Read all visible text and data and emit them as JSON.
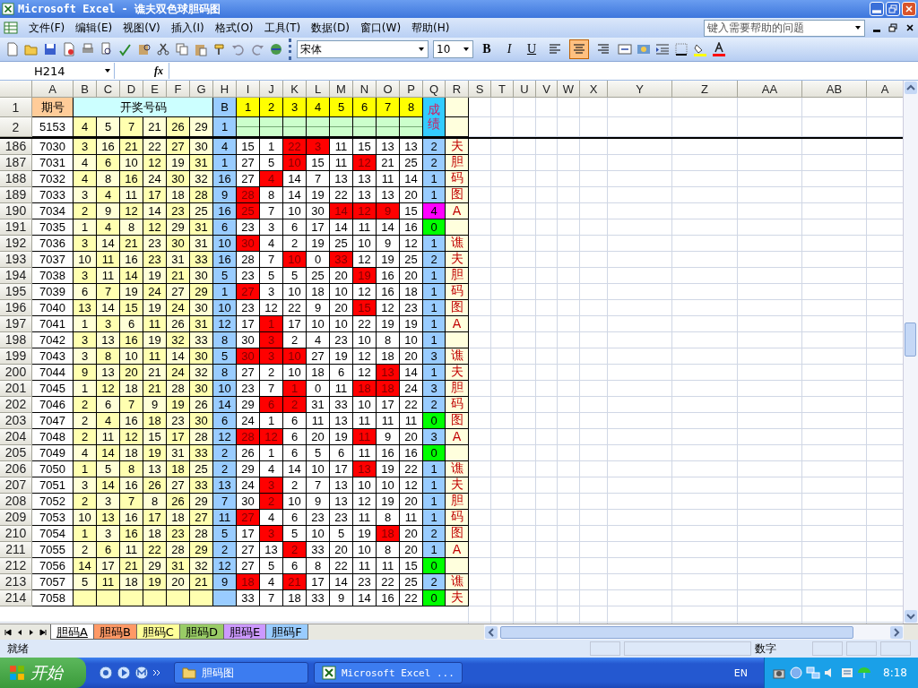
{
  "window": {
    "title": "Microsoft Excel - 谯夫双色球胆码图"
  },
  "menu": [
    "文件(F)",
    "编辑(E)",
    "视图(V)",
    "插入(I)",
    "格式(O)",
    "工具(T)",
    "数据(D)",
    "窗口(W)",
    "帮助(H)"
  ],
  "help_box": {
    "placeholder": "键入需要帮助的问题"
  },
  "format_bar": {
    "font": "宋体",
    "font_size": "10",
    "bold": "B",
    "italic": "I",
    "underline": "U",
    "alignment": [
      {
        "kind": "left",
        "selected": false
      },
      {
        "kind": "center",
        "selected": true
      },
      {
        "kind": "right",
        "selected": false
      }
    ]
  },
  "formula_bar": {
    "name_box": "H214",
    "fx": "fx"
  },
  "columns": [
    "A",
    "B",
    "C",
    "D",
    "E",
    "F",
    "G",
    "H",
    "I",
    "J",
    "K",
    "L",
    "M",
    "N",
    "O",
    "P",
    "Q",
    "R",
    "S",
    "T",
    "U",
    "V",
    "W",
    "X",
    "Y",
    "Z",
    "AA",
    "AB",
    "A"
  ],
  "header": {
    "row_1": "1",
    "row_2": "2",
    "period_label": "期号",
    "draw_label": "开奖号码",
    "blue_label": "B",
    "slots": [
      "1",
      "2",
      "3",
      "4",
      "5",
      "6",
      "7",
      "8"
    ],
    "score_label": "成绩",
    "period": "5153",
    "balls": [
      "4",
      "5",
      "7",
      "21",
      "26",
      "29"
    ],
    "blue": "1"
  },
  "rows": [
    {
      "n": "186",
      "period": "7030",
      "balls": [
        "3",
        "16",
        "21",
        "22",
        "27",
        "30"
      ],
      "blue": "4",
      "cells": [
        {
          "value": "15",
          "hit": false
        },
        {
          "value": "1",
          "hit": false
        },
        {
          "value": "22",
          "hit": true
        },
        {
          "value": "3",
          "hit": true
        },
        {
          "value": "11",
          "hit": false
        },
        {
          "value": "15",
          "hit": false
        },
        {
          "value": "13",
          "hit": false
        },
        {
          "value": "13",
          "hit": false
        }
      ],
      "score": "2",
      "color": "#99ccff",
      "note": "夫"
    },
    {
      "n": "187",
      "period": "7031",
      "balls": [
        "4",
        "6",
        "10",
        "12",
        "19",
        "31"
      ],
      "blue": "1",
      "cells": [
        {
          "value": "27",
          "hit": false
        },
        {
          "value": "5",
          "hit": false
        },
        {
          "value": "10",
          "hit": true
        },
        {
          "value": "15",
          "hit": false
        },
        {
          "value": "11",
          "hit": false
        },
        {
          "value": "12",
          "hit": true
        },
        {
          "value": "21",
          "hit": false
        },
        {
          "value": "25",
          "hit": false
        }
      ],
      "score": "2",
      "color": "#99ccff",
      "note": "胆"
    },
    {
      "n": "188",
      "period": "7032",
      "balls": [
        "4",
        "8",
        "16",
        "24",
        "30",
        "32"
      ],
      "blue": "16",
      "cells": [
        {
          "value": "27",
          "hit": false
        },
        {
          "value": "4",
          "hit": true
        },
        {
          "value": "14",
          "hit": false
        },
        {
          "value": "7",
          "hit": false
        },
        {
          "value": "13",
          "hit": false
        },
        {
          "value": "13",
          "hit": false
        },
        {
          "value": "11",
          "hit": false
        },
        {
          "value": "14",
          "hit": false
        }
      ],
      "score": "1",
      "color": "#99ccff",
      "note": "码"
    },
    {
      "n": "189",
      "period": "7033",
      "balls": [
        "3",
        "4",
        "11",
        "17",
        "18",
        "28"
      ],
      "blue": "9",
      "cells": [
        {
          "value": "28",
          "hit": true
        },
        {
          "value": "8",
          "hit": false
        },
        {
          "value": "14",
          "hit": false
        },
        {
          "value": "19",
          "hit": false
        },
        {
          "value": "22",
          "hit": false
        },
        {
          "value": "13",
          "hit": false
        },
        {
          "value": "13",
          "hit": false
        },
        {
          "value": "20",
          "hit": false
        }
      ],
      "score": "1",
      "color": "#99ccff",
      "note": "图"
    },
    {
      "n": "190",
      "period": "7034",
      "balls": [
        "2",
        "9",
        "12",
        "14",
        "23",
        "25"
      ],
      "blue": "16",
      "cells": [
        {
          "value": "25",
          "hit": true
        },
        {
          "value": "7",
          "hit": false
        },
        {
          "value": "10",
          "hit": false
        },
        {
          "value": "30",
          "hit": false
        },
        {
          "value": "14",
          "hit": true
        },
        {
          "value": "12",
          "hit": true
        },
        {
          "value": "9",
          "hit": true
        },
        {
          "value": "15",
          "hit": false
        }
      ],
      "score": "4",
      "color": "#ff00ff",
      "note": "A"
    },
    {
      "n": "191",
      "period": "7035",
      "balls": [
        "1",
        "4",
        "8",
        "12",
        "29",
        "31"
      ],
      "blue": "6",
      "cells": [
        {
          "value": "23",
          "hit": false
        },
        {
          "value": "3",
          "hit": false
        },
        {
          "value": "6",
          "hit": false
        },
        {
          "value": "17",
          "hit": false
        },
        {
          "value": "14",
          "hit": false
        },
        {
          "value": "11",
          "hit": false
        },
        {
          "value": "14",
          "hit": false
        },
        {
          "value": "16",
          "hit": false
        }
      ],
      "score": "0",
      "color": "#00ff00"
    },
    {
      "n": "192",
      "period": "7036",
      "balls": [
        "3",
        "14",
        "21",
        "23",
        "30",
        "31"
      ],
      "blue": "10",
      "cells": [
        {
          "value": "30",
          "hit": true
        },
        {
          "value": "4",
          "hit": false
        },
        {
          "value": "2",
          "hit": false
        },
        {
          "value": "19",
          "hit": false
        },
        {
          "value": "25",
          "hit": false
        },
        {
          "value": "10",
          "hit": false
        },
        {
          "value": "9",
          "hit": false
        },
        {
          "value": "12",
          "hit": false
        }
      ],
      "score": "1",
      "color": "#99ccff",
      "note": "谯"
    },
    {
      "n": "193",
      "period": "7037",
      "balls": [
        "10",
        "11",
        "16",
        "23",
        "31",
        "33"
      ],
      "blue": "16",
      "cells": [
        {
          "value": "28",
          "hit": false
        },
        {
          "value": "7",
          "hit": false
        },
        {
          "value": "10",
          "hit": true
        },
        {
          "value": "0",
          "hit": false
        },
        {
          "value": "33",
          "hit": true
        },
        {
          "value": "12",
          "hit": false
        },
        {
          "value": "19",
          "hit": false
        },
        {
          "value": "25",
          "hit": false
        }
      ],
      "score": "2",
      "color": "#99ccff",
      "note": "夫"
    },
    {
      "n": "194",
      "period": "7038",
      "balls": [
        "3",
        "11",
        "14",
        "19",
        "21",
        "30"
      ],
      "blue": "5",
      "cells": [
        {
          "value": "23",
          "hit": false
        },
        {
          "value": "5",
          "hit": false
        },
        {
          "value": "5",
          "hit": false
        },
        {
          "value": "25",
          "hit": false
        },
        {
          "value": "20",
          "hit": false
        },
        {
          "value": "19",
          "hit": true
        },
        {
          "value": "16",
          "hit": false
        },
        {
          "value": "20",
          "hit": false
        }
      ],
      "score": "1",
      "color": "#99ccff",
      "note": "胆"
    },
    {
      "n": "195",
      "period": "7039",
      "balls": [
        "6",
        "7",
        "19",
        "24",
        "27",
        "29"
      ],
      "blue": "1",
      "cells": [
        {
          "value": "27",
          "hit": true
        },
        {
          "value": "3",
          "hit": false
        },
        {
          "value": "10",
          "hit": false
        },
        {
          "value": "18",
          "hit": false
        },
        {
          "value": "10",
          "hit": false
        },
        {
          "value": "12",
          "hit": false
        },
        {
          "value": "16",
          "hit": false
        },
        {
          "value": "18",
          "hit": false
        }
      ],
      "score": "1",
      "color": "#99ccff",
      "note": "码"
    },
    {
      "n": "196",
      "period": "7040",
      "balls": [
        "13",
        "14",
        "15",
        "19",
        "24",
        "30"
      ],
      "blue": "10",
      "cells": [
        {
          "value": "23",
          "hit": false
        },
        {
          "value": "12",
          "hit": false
        },
        {
          "value": "22",
          "hit": false
        },
        {
          "value": "9",
          "hit": false
        },
        {
          "value": "20",
          "hit": false
        },
        {
          "value": "15",
          "hit": true
        },
        {
          "value": "12",
          "hit": false
        },
        {
          "value": "23",
          "hit": false
        }
      ],
      "score": "1",
      "color": "#99ccff",
      "note": "图"
    },
    {
      "n": "197",
      "period": "7041",
      "balls": [
        "1",
        "3",
        "6",
        "11",
        "26",
        "31"
      ],
      "blue": "12",
      "cells": [
        {
          "value": "17",
          "hit": false
        },
        {
          "value": "1",
          "hit": true
        },
        {
          "value": "17",
          "hit": false
        },
        {
          "value": "10",
          "hit": false
        },
        {
          "value": "10",
          "hit": false
        },
        {
          "value": "22",
          "hit": false
        },
        {
          "value": "19",
          "hit": false
        },
        {
          "value": "19",
          "hit": false
        }
      ],
      "score": "1",
      "color": "#99ccff",
      "note": "A"
    },
    {
      "n": "198",
      "period": "7042",
      "balls": [
        "3",
        "13",
        "16",
        "19",
        "32",
        "33"
      ],
      "blue": "8",
      "cells": [
        {
          "value": "30",
          "hit": false
        },
        {
          "value": "3",
          "hit": true
        },
        {
          "value": "2",
          "hit": false
        },
        {
          "value": "4",
          "hit": false
        },
        {
          "value": "23",
          "hit": false
        },
        {
          "value": "10",
          "hit": false
        },
        {
          "value": "8",
          "hit": false
        },
        {
          "value": "10",
          "hit": false
        }
      ],
      "score": "1",
      "color": "#99ccff"
    },
    {
      "n": "199",
      "period": "7043",
      "balls": [
        "3",
        "8",
        "10",
        "11",
        "14",
        "30"
      ],
      "blue": "5",
      "cells": [
        {
          "value": "30",
          "hit": true
        },
        {
          "value": "3",
          "hit": true
        },
        {
          "value": "10",
          "hit": true
        },
        {
          "value": "27",
          "hit": false
        },
        {
          "value": "19",
          "hit": false
        },
        {
          "value": "12",
          "hit": false
        },
        {
          "value": "18",
          "hit": false
        },
        {
          "value": "20",
          "hit": false
        }
      ],
      "score": "3",
      "color": "#99ccff",
      "note": "谯"
    },
    {
      "n": "200",
      "period": "7044",
      "balls": [
        "9",
        "13",
        "20",
        "21",
        "24",
        "32"
      ],
      "blue": "8",
      "cells": [
        {
          "value": "27",
          "hit": false
        },
        {
          "value": "2",
          "hit": false
        },
        {
          "value": "10",
          "hit": false
        },
        {
          "value": "18",
          "hit": false
        },
        {
          "value": "6",
          "hit": false
        },
        {
          "value": "12",
          "hit": false
        },
        {
          "value": "13",
          "hit": true
        },
        {
          "value": "14",
          "hit": false
        }
      ],
      "score": "1",
      "color": "#99ccff",
      "note": "夫"
    },
    {
      "n": "201",
      "period": "7045",
      "balls": [
        "1",
        "12",
        "18",
        "21",
        "28",
        "30"
      ],
      "blue": "10",
      "cells": [
        {
          "value": "23",
          "hit": false
        },
        {
          "value": "7",
          "hit": false
        },
        {
          "value": "1",
          "hit": true
        },
        {
          "value": "0",
          "hit": false
        },
        {
          "value": "11",
          "hit": false
        },
        {
          "value": "18",
          "hit": true
        },
        {
          "value": "18",
          "hit": true
        },
        {
          "value": "24",
          "hit": false
        }
      ],
      "score": "3",
      "color": "#99ccff",
      "note": "胆"
    },
    {
      "n": "202",
      "period": "7046",
      "balls": [
        "2",
        "6",
        "7",
        "9",
        "19",
        "26"
      ],
      "blue": "14",
      "cells": [
        {
          "value": "29",
          "hit": false
        },
        {
          "value": "6",
          "hit": true
        },
        {
          "value": "2",
          "hit": true
        },
        {
          "value": "31",
          "hit": false
        },
        {
          "value": "33",
          "hit": false
        },
        {
          "value": "10",
          "hit": false
        },
        {
          "value": "17",
          "hit": false
        },
        {
          "value": "22",
          "hit": false
        }
      ],
      "score": "2",
      "color": "#99ccff",
      "note": "码"
    },
    {
      "n": "203",
      "period": "7047",
      "balls": [
        "2",
        "4",
        "16",
        "18",
        "23",
        "30"
      ],
      "blue": "6",
      "cells": [
        {
          "value": "24",
          "hit": false
        },
        {
          "value": "1",
          "hit": false
        },
        {
          "value": "6",
          "hit": false
        },
        {
          "value": "11",
          "hit": false
        },
        {
          "value": "13",
          "hit": false
        },
        {
          "value": "11",
          "hit": false
        },
        {
          "value": "11",
          "hit": false
        },
        {
          "value": "11",
          "hit": false
        }
      ],
      "score": "0",
      "color": "#00ff00",
      "note": "图"
    },
    {
      "n": "204",
      "period": "7048",
      "balls": [
        "2",
        "11",
        "12",
        "15",
        "17",
        "28"
      ],
      "blue": "12",
      "cells": [
        {
          "value": "28",
          "hit": true
        },
        {
          "value": "12",
          "hit": true
        },
        {
          "value": "6",
          "hit": false
        },
        {
          "value": "20",
          "hit": false
        },
        {
          "value": "19",
          "hit": false
        },
        {
          "value": "11",
          "hit": true
        },
        {
          "value": "9",
          "hit": false
        },
        {
          "value": "20",
          "hit": false
        }
      ],
      "score": "3",
      "color": "#99ccff",
      "note": "A"
    },
    {
      "n": "205",
      "period": "7049",
      "balls": [
        "4",
        "14",
        "18",
        "19",
        "31",
        "33"
      ],
      "blue": "2",
      "cells": [
        {
          "value": "26",
          "hit": false
        },
        {
          "value": "1",
          "hit": false
        },
        {
          "value": "6",
          "hit": false
        },
        {
          "value": "5",
          "hit": false
        },
        {
          "value": "6",
          "hit": false
        },
        {
          "value": "11",
          "hit": false
        },
        {
          "value": "16",
          "hit": false
        },
        {
          "value": "16",
          "hit": false
        }
      ],
      "score": "0",
      "color": "#00ff00"
    },
    {
      "n": "206",
      "period": "7050",
      "balls": [
        "1",
        "5",
        "8",
        "13",
        "18",
        "25"
      ],
      "blue": "2",
      "cells": [
        {
          "value": "29",
          "hit": false
        },
        {
          "value": "4",
          "hit": false
        },
        {
          "value": "14",
          "hit": false
        },
        {
          "value": "10",
          "hit": false
        },
        {
          "value": "17",
          "hit": false
        },
        {
          "value": "13",
          "hit": true
        },
        {
          "value": "19",
          "hit": false
        },
        {
          "value": "22",
          "hit": false
        }
      ],
      "score": "1",
      "color": "#99ccff",
      "note": "谯"
    },
    {
      "n": "207",
      "period": "7051",
      "balls": [
        "3",
        "14",
        "16",
        "26",
        "27",
        "33"
      ],
      "blue": "13",
      "cells": [
        {
          "value": "24",
          "hit": false
        },
        {
          "value": "3",
          "hit": true
        },
        {
          "value": "2",
          "hit": false
        },
        {
          "value": "7",
          "hit": false
        },
        {
          "value": "13",
          "hit": false
        },
        {
          "value": "10",
          "hit": false
        },
        {
          "value": "10",
          "hit": false
        },
        {
          "value": "12",
          "hit": false
        }
      ],
      "score": "1",
      "color": "#99ccff",
      "note": "夫"
    },
    {
      "n": "208",
      "period": "7052",
      "balls": [
        "2",
        "3",
        "7",
        "8",
        "26",
        "29"
      ],
      "blue": "7",
      "cells": [
        {
          "value": "30",
          "hit": false
        },
        {
          "value": "2",
          "hit": true
        },
        {
          "value": "10",
          "hit": false
        },
        {
          "value": "9",
          "hit": false
        },
        {
          "value": "13",
          "hit": false
        },
        {
          "value": "12",
          "hit": false
        },
        {
          "value": "19",
          "hit": false
        },
        {
          "value": "20",
          "hit": false
        }
      ],
      "score": "1",
      "color": "#99ccff",
      "note": "胆"
    },
    {
      "n": "209",
      "period": "7053",
      "balls": [
        "10",
        "13",
        "16",
        "17",
        "18",
        "27"
      ],
      "blue": "11",
      "cells": [
        {
          "value": "27",
          "hit": true
        },
        {
          "value": "4",
          "hit": false
        },
        {
          "value": "6",
          "hit": false
        },
        {
          "value": "23",
          "hit": false
        },
        {
          "value": "23",
          "hit": false
        },
        {
          "value": "11",
          "hit": false
        },
        {
          "value": "8",
          "hit": false
        },
        {
          "value": "11",
          "hit": false
        }
      ],
      "score": "1",
      "color": "#99ccff",
      "note": "码"
    },
    {
      "n": "210",
      "period": "7054",
      "balls": [
        "1",
        "3",
        "16",
        "18",
        "23",
        "28"
      ],
      "blue": "5",
      "cells": [
        {
          "value": "17",
          "hit": false
        },
        {
          "value": "3",
          "hit": true
        },
        {
          "value": "5",
          "hit": false
        },
        {
          "value": "10",
          "hit": false
        },
        {
          "value": "5",
          "hit": false
        },
        {
          "value": "19",
          "hit": false
        },
        {
          "value": "18",
          "hit": true
        },
        {
          "value": "20",
          "hit": false
        }
      ],
      "score": "2",
      "color": "#99ccff",
      "note": "图"
    },
    {
      "n": "211",
      "period": "7055",
      "balls": [
        "2",
        "6",
        "11",
        "22",
        "28",
        "29"
      ],
      "blue": "2",
      "cells": [
        {
          "value": "27",
          "hit": false
        },
        {
          "value": "13",
          "hit": false
        },
        {
          "value": "2",
          "hit": true
        },
        {
          "value": "33",
          "hit": false
        },
        {
          "value": "20",
          "hit": false
        },
        {
          "value": "10",
          "hit": false
        },
        {
          "value": "8",
          "hit": false
        },
        {
          "value": "20",
          "hit": false
        }
      ],
      "score": "1",
      "color": "#99ccff",
      "note": "A"
    },
    {
      "n": "212",
      "period": "7056",
      "balls": [
        "14",
        "17",
        "21",
        "29",
        "31",
        "32"
      ],
      "blue": "12",
      "cells": [
        {
          "value": "27",
          "hit": false
        },
        {
          "value": "5",
          "hit": false
        },
        {
          "value": "6",
          "hit": false
        },
        {
          "value": "8",
          "hit": false
        },
        {
          "value": "22",
          "hit": false
        },
        {
          "value": "11",
          "hit": false
        },
        {
          "value": "11",
          "hit": false
        },
        {
          "value": "15",
          "hit": false
        }
      ],
      "score": "0",
      "color": "#00ff00"
    },
    {
      "n": "213",
      "period": "7057",
      "balls": [
        "5",
        "11",
        "18",
        "19",
        "20",
        "21"
      ],
      "blue": "9",
      "cells": [
        {
          "value": "18",
          "hit": true
        },
        {
          "value": "4",
          "hit": false
        },
        {
          "value": "21",
          "hit": true
        },
        {
          "value": "17",
          "hit": false
        },
        {
          "value": "14",
          "hit": false
        },
        {
          "value": "23",
          "hit": false
        },
        {
          "value": "22",
          "hit": false
        },
        {
          "value": "25",
          "hit": false
        }
      ],
      "score": "2",
      "color": "#99ccff",
      "note": "谯"
    },
    {
      "n": "214",
      "period": "7058",
      "cells": [
        {
          "value": "33",
          "hit": false
        },
        {
          "value": "7",
          "hit": false
        },
        {
          "value": "18",
          "hit": false
        },
        {
          "value": "33",
          "hit": false
        },
        {
          "value": "9",
          "hit": false
        },
        {
          "value": "14",
          "hit": false
        },
        {
          "value": "16",
          "hit": false
        },
        {
          "value": "22",
          "hit": false
        }
      ],
      "score": "0",
      "color": "#00ff00",
      "note": "夫"
    }
  ],
  "sheet_tabs": [
    {
      "label": "胆码A",
      "selected": true
    },
    {
      "label": "胆码B",
      "selected": false,
      "color": "#ff9966"
    },
    {
      "label": "胆码C",
      "selected": false,
      "color": "#ffff99"
    },
    {
      "label": "胆码D",
      "selected": false,
      "color": "#99cc66"
    },
    {
      "label": "胆码E",
      "selected": false,
      "color": "#cc99ff"
    },
    {
      "label": "胆码F",
      "selected": false,
      "color": "#99ccff"
    }
  ],
  "status_bar": {
    "text": "就绪",
    "mode": "数字"
  },
  "taskbar": {
    "start": "开始",
    "tasks": [
      {
        "label": "胆码图",
        "kind": "folder"
      },
      {
        "label": "Microsoft Excel ...",
        "kind": "excel"
      }
    ],
    "language": "EN",
    "clock": "8:18"
  }
}
